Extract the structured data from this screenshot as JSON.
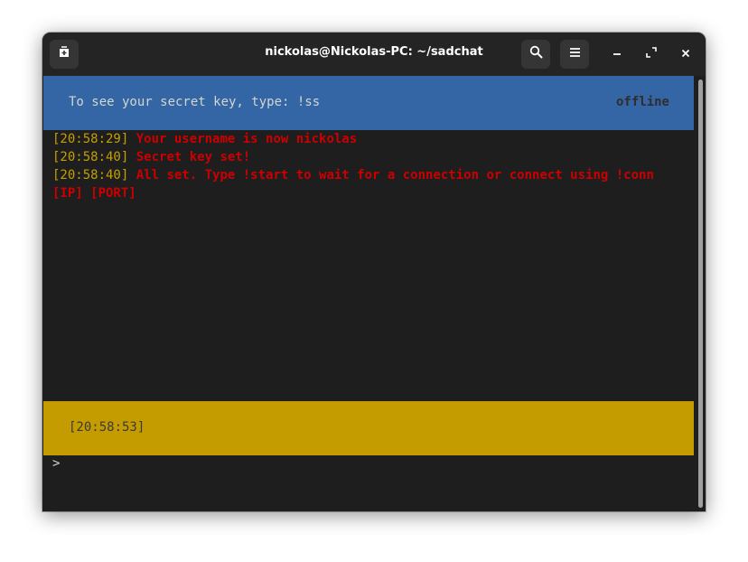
{
  "window": {
    "title": "nickolas@Nickolas-PC: ~/sadchat"
  },
  "titlebar": {
    "new_tab_icon": "new-tab-icon",
    "search_icon": "search-icon",
    "menu_icon": "hamburger-menu-icon",
    "minimize_icon": "minimize-icon",
    "maximize_icon": "maximize-icon",
    "close_icon": "close-icon"
  },
  "banner": {
    "text": "To see your secret key, type: !ss",
    "status": "offline"
  },
  "log": [
    {
      "time": "[20:58:29]",
      "msg": "Your username is now nickolas"
    },
    {
      "time": "[20:58:40]",
      "msg": "Secret key set!"
    },
    {
      "time": "[20:58:40]",
      "msg": "All set. Type !start to wait for a connection or connect using !conn"
    },
    {
      "time": "",
      "msg": "[IP] [PORT]"
    }
  ],
  "statusbar": {
    "time": "[20:58:53]"
  },
  "input": {
    "prompt": ">",
    "value": ""
  },
  "colors": {
    "banner_bg": "#3465a4",
    "statusbar_bg": "#c49c00",
    "timestamp": "#c4a000",
    "message": "#cc0000",
    "terminal_bg": "#1e1e1e",
    "titlebar_bg": "#242424"
  }
}
